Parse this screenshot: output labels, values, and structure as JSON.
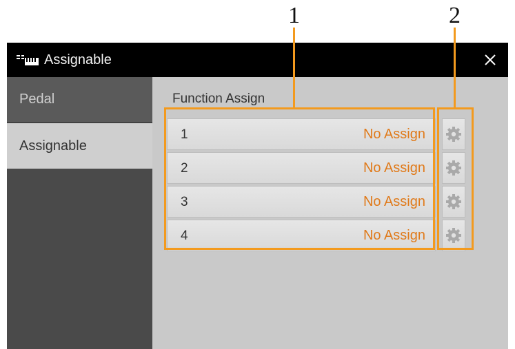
{
  "callouts": [
    "1",
    "2"
  ],
  "window": {
    "title": "Assignable",
    "close_glyph": "×",
    "app_icon": "keyboard-icon"
  },
  "sidebar": {
    "tabs": [
      {
        "label": "Pedal",
        "active": false
      },
      {
        "label": "Assignable",
        "active": true
      }
    ]
  },
  "main": {
    "section_title": "Function Assign",
    "rows": [
      {
        "number": "1",
        "value": "No Assign"
      },
      {
        "number": "2",
        "value": "No Assign"
      },
      {
        "number": "3",
        "value": "No Assign"
      },
      {
        "number": "4",
        "value": "No Assign"
      }
    ],
    "settings_icon": "gear-icon"
  },
  "colors": {
    "accent": "#e07a1a",
    "callout": "#f39a1e",
    "titlebar": "#000000",
    "sidebar": "#4a4a4a",
    "panel": "#c9c9c9"
  }
}
